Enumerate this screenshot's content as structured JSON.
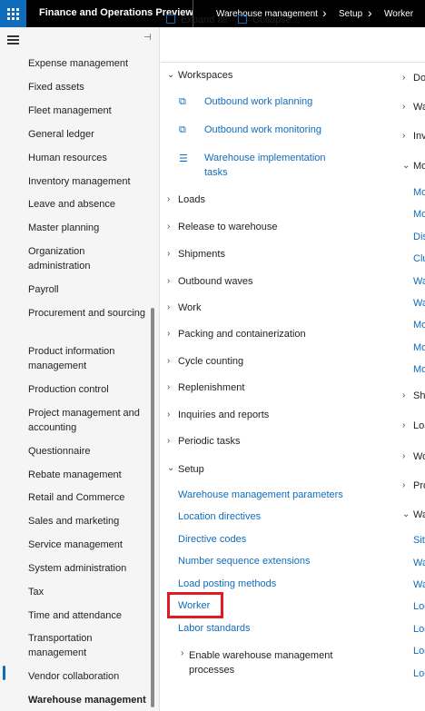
{
  "topbar": {
    "app_title": "Finance and Operations Preview",
    "breadcrumbs": [
      "Warehouse management",
      "Setup",
      "Worker"
    ]
  },
  "sidebar": {
    "modules": [
      "Expense management",
      "Fixed assets",
      "Fleet management",
      "General ledger",
      "Human resources",
      "Inventory management",
      "Leave and absence",
      "Master planning",
      "Organization administration",
      "Payroll",
      "Procurement and sourcing",
      "Product information management",
      "Production control",
      "Project management and accounting",
      "Questionnaire",
      "Rebate management",
      "Retail and Commerce",
      "Sales and marketing",
      "Service management",
      "System administration",
      "Tax",
      "Time and attendance",
      "Transportation management",
      "Vendor collaboration",
      "Warehouse management"
    ],
    "active": "Warehouse management"
  },
  "toolbar": {
    "expand_all": "Expand all",
    "collapse": "Collapse..."
  },
  "main": {
    "workspaces_label": "Workspaces",
    "workspaces": [
      "Outbound work planning",
      "Outbound work monitoring",
      "Warehouse implementation tasks"
    ],
    "groups": [
      "Loads",
      "Release to warehouse",
      "Shipments",
      "Outbound waves",
      "Work",
      "Packing and containerization",
      "Cycle counting",
      "Replenishment",
      "Inquiries and reports",
      "Periodic tasks"
    ],
    "setup_label": "Setup",
    "setup_links": [
      "Warehouse management parameters",
      "Location directives",
      "Directive codes",
      "Number sequence extensions",
      "Load posting methods",
      "Worker",
      "Labor standards"
    ],
    "setup_subgroup": "Enable warehouse management processes"
  },
  "right_column": {
    "items": [
      {
        "text": "Do",
        "kind": "group"
      },
      {
        "text": "Wa",
        "kind": "group"
      },
      {
        "text": "Inv",
        "kind": "group"
      },
      {
        "text": "Mo",
        "kind": "open"
      },
      {
        "text": "Mo",
        "kind": "link"
      },
      {
        "text": "Mo",
        "kind": "link"
      },
      {
        "text": "Dis",
        "kind": "link"
      },
      {
        "text": "Clu",
        "kind": "link"
      },
      {
        "text": "Wa",
        "kind": "link"
      },
      {
        "text": "Wa",
        "kind": "link"
      },
      {
        "text": "Mo",
        "kind": "link"
      },
      {
        "text": "Mo",
        "kind": "link"
      },
      {
        "text": "Mo",
        "kind": "link"
      },
      {
        "text": "Shi",
        "kind": "group"
      },
      {
        "text": "Loa",
        "kind": "group"
      },
      {
        "text": "Wo",
        "kind": "group"
      },
      {
        "text": "Pro",
        "kind": "group"
      },
      {
        "text": "Wa",
        "kind": "open"
      },
      {
        "text": "Site",
        "kind": "link"
      },
      {
        "text": "Wa",
        "kind": "link"
      },
      {
        "text": "Wa",
        "kind": "link"
      },
      {
        "text": "Loc",
        "kind": "link"
      },
      {
        "text": "Loc",
        "kind": "link"
      },
      {
        "text": "Loc",
        "kind": "link"
      },
      {
        "text": "Loc",
        "kind": "link"
      }
    ]
  },
  "colors": {
    "accent": "#0f6cbd",
    "highlight": "#e11b22",
    "topbar": "#000000"
  }
}
